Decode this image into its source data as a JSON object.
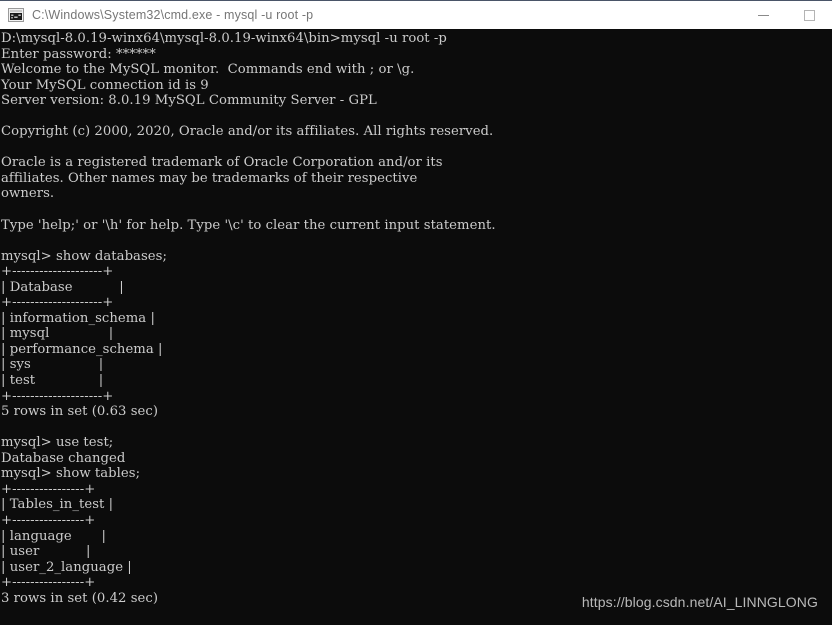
{
  "window": {
    "title": "C:\\Windows\\System32\\cmd.exe - mysql  -u root -p",
    "icon_name": "cmd-console-icon",
    "titlebar_bg": "#ffffff",
    "titlebar_text_color": "#767676",
    "console_bg": "#0c0c0c",
    "console_text_color": "#cccccc",
    "controls": {
      "minimize_label": "—",
      "maximize_label": "□"
    }
  },
  "console": {
    "lines": [
      "D:\\mysql-8.0.19-winx64\\mysql-8.0.19-winx64\\bin>mysql -u root -p",
      "Enter password: ******",
      "Welcome to the MySQL monitor.  Commands end with ; or \\g.",
      "Your MySQL connection id is 9",
      "Server version: 8.0.19 MySQL Community Server - GPL",
      "",
      "Copyright (c) 2000, 2020, Oracle and/or its affiliates. All rights reserved.",
      "",
      "Oracle is a registered trademark of Oracle Corporation and/or its",
      "affiliates. Other names may be trademarks of their respective",
      "owners.",
      "",
      "Type 'help;' or '\\h' for help. Type '\\c' to clear the current input statement.",
      "",
      "mysql> show databases;",
      "+--------------------+",
      "| Database           |",
      "+--------------------+",
      "| information_schema |",
      "| mysql              |",
      "| performance_schema |",
      "| sys                |",
      "| test               |",
      "+--------------------+",
      "5 rows in set (0.63 sec)",
      "",
      "mysql> use test;",
      "Database changed",
      "mysql> show tables;",
      "+----------------+",
      "| Tables_in_test |",
      "+----------------+",
      "| language       |",
      "| user           |",
      "| user_2_language |",
      "+----------------+",
      "3 rows in set (0.42 sec)"
    ],
    "prompt": "mysql>",
    "commands": [
      "mysql -u root -p",
      "show databases;",
      "use test;",
      "show tables;"
    ],
    "server_info": {
      "connection_id": "9",
      "server_version": "8.0.19 MySQL Community Server - GPL",
      "password_mask": "******",
      "copyright": "Copyright (c) 2000, 2020, Oracle and/or its affiliates. All rights reserved."
    },
    "databases_result": {
      "column_header": "Database",
      "rows": [
        "information_schema",
        "mysql",
        "performance_schema",
        "sys",
        "test"
      ],
      "footer": "5 rows in set (0.63 sec)"
    },
    "tables_result": {
      "column_header": "Tables_in_test",
      "rows": [
        "language",
        "user",
        "user_2_language"
      ],
      "footer": "3 rows in set (0.42 sec)"
    }
  },
  "watermark": {
    "text": "https://blog.csdn.net/AI_LINNGLONG"
  }
}
